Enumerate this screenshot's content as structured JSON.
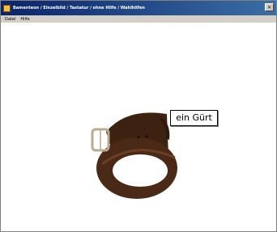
{
  "window": {
    "title": "Bamenteon / Einzelbild / Tastatur / ohne Hilfe / Wahlhilfen",
    "close_label": "×"
  },
  "menu": [
    {
      "label": "Datei"
    },
    {
      "label": "Hilfe"
    }
  ],
  "content": {
    "caption": "ein Gürt",
    "image": "leather-belt"
  },
  "colors": {
    "titlebar_start": "#0a246a",
    "titlebar_end": "#3a6ea5",
    "belt_leather": "#4a2a16",
    "buckle": "#b8ab90"
  }
}
